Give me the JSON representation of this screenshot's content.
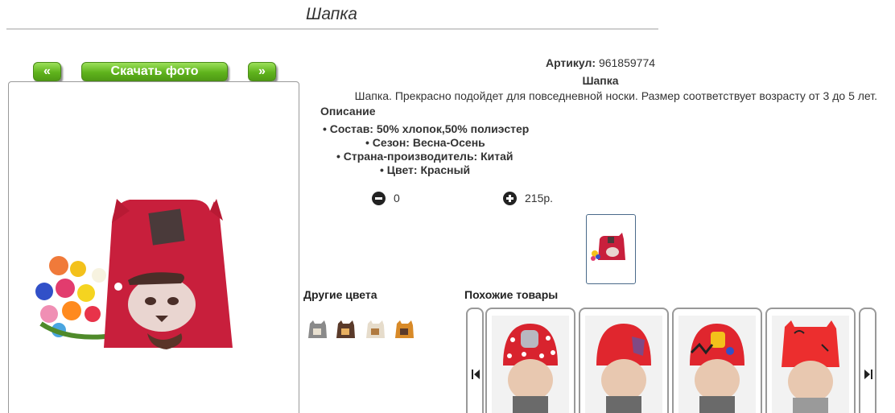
{
  "page": {
    "title": "Шапка"
  },
  "gallery": {
    "prev_label": "«",
    "download_label": "Скачать фото",
    "next_label": "»"
  },
  "product": {
    "sku_label": "Артикул:",
    "sku_value": "961859774",
    "name": "Шапка",
    "description": "Шапка. Прекрасно подойдет для повседневной носки. Размер соответствует возрасту от 3 до 5 лет.",
    "description_heading": "Описание",
    "specs": [
      "• Состав: 50% хлопок,50% полиэстер",
      "• Сезон: Весна-Осень",
      "• Страна-производитель: Китай",
      "• Цвет: Красный"
    ],
    "quantity": "0",
    "price": "215р."
  },
  "other_colors": {
    "heading": "Другие цвета",
    "swatches": [
      "grey-hat-icon",
      "brown-hat-icon",
      "beige-hat-icon",
      "orange-hat-icon"
    ]
  },
  "similar": {
    "heading": "Похожие товары",
    "items": [
      "red-dotted-hat",
      "red-hat",
      "red-pattern-hat",
      "red-cat-hat"
    ]
  },
  "colors": {
    "accent_green": "#5fb31c",
    "hat_red": "#c81f3c",
    "border_grey": "#999999"
  }
}
